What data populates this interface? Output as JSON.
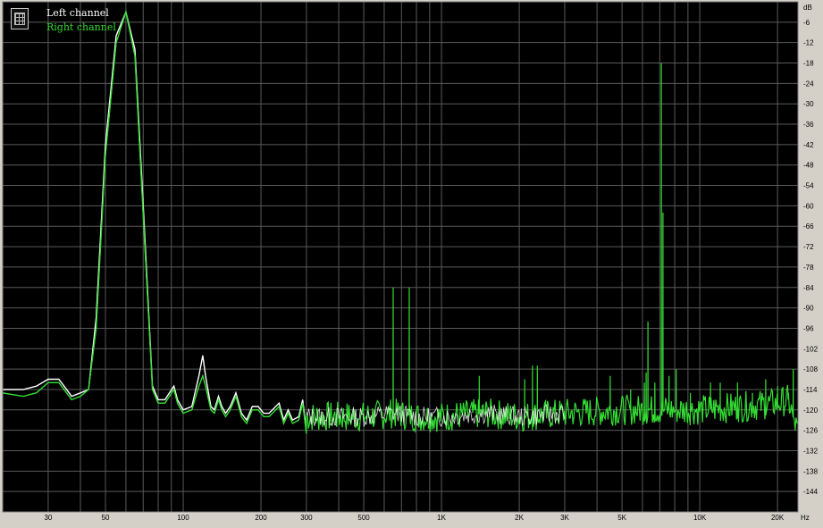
{
  "chart_data": {
    "type": "line",
    "x_scale": "log",
    "xlim": [
      20,
      24000
    ],
    "ylim": [
      -150,
      0
    ],
    "y_unit": "dB",
    "x_unit": "Hz",
    "grid": true,
    "legend_position": "top-left",
    "colors": {
      "background": "#000000",
      "grid": "#5a5a5a",
      "left": "#ffffff",
      "right": "#33dd33"
    },
    "x_ticks": [
      {
        "value": 30,
        "label": "30"
      },
      {
        "value": 50,
        "label": "50"
      },
      {
        "value": 100,
        "label": "100"
      },
      {
        "value": 200,
        "label": "200"
      },
      {
        "value": 300,
        "label": "300"
      },
      {
        "value": 500,
        "label": "500"
      },
      {
        "value": 1000,
        "label": "1K"
      },
      {
        "value": 2000,
        "label": "2K"
      },
      {
        "value": 3000,
        "label": "3K"
      },
      {
        "value": 5000,
        "label": "5K"
      },
      {
        "value": 10000,
        "label": "10K"
      },
      {
        "value": 20000,
        "label": "20K"
      }
    ],
    "y_ticks": [
      -6,
      -12,
      -18,
      -24,
      -30,
      -36,
      -42,
      -48,
      -54,
      -60,
      -66,
      -72,
      -78,
      -84,
      -90,
      -96,
      -102,
      -108,
      -114,
      -120,
      -126,
      -132,
      -138,
      -144
    ],
    "series": [
      {
        "name": "Left channel",
        "color": "#ffffff",
        "points": [
          [
            20,
            -114
          ],
          [
            24,
            -114
          ],
          [
            27,
            -113
          ],
          [
            30,
            -111
          ],
          [
            33,
            -111
          ],
          [
            37,
            -116
          ],
          [
            40,
            -115
          ],
          [
            43,
            -114
          ],
          [
            46,
            -93
          ],
          [
            50,
            -42
          ],
          [
            55,
            -10
          ],
          [
            60,
            -3
          ],
          [
            65,
            -14
          ],
          [
            70,
            -60
          ],
          [
            76,
            -113
          ],
          [
            80,
            -117
          ],
          [
            85,
            -117
          ],
          [
            92,
            -113
          ],
          [
            95,
            -117
          ],
          [
            100,
            -120
          ],
          [
            108,
            -119
          ],
          [
            115,
            -110
          ],
          [
            119,
            -104
          ],
          [
            122,
            -110
          ],
          [
            128,
            -119
          ],
          [
            132,
            -120
          ],
          [
            137,
            -116
          ],
          [
            141,
            -119
          ],
          [
            146,
            -121
          ],
          [
            152,
            -119
          ],
          [
            160,
            -115
          ],
          [
            168,
            -121
          ],
          [
            176,
            -123
          ],
          [
            185,
            -119
          ],
          [
            195,
            -119
          ],
          [
            205,
            -121
          ],
          [
            215,
            -121
          ],
          [
            235,
            -118
          ],
          [
            245,
            -123
          ],
          [
            255,
            -120
          ],
          [
            265,
            -123
          ],
          [
            280,
            -122
          ],
          [
            290,
            -117
          ],
          [
            300,
            -126
          ]
        ]
      },
      {
        "name": "Right channel",
        "color": "#33dd33",
        "points": [
          [
            20,
            -115
          ],
          [
            24,
            -116
          ],
          [
            27,
            -115
          ],
          [
            30,
            -112
          ],
          [
            33,
            -112
          ],
          [
            37,
            -117
          ],
          [
            40,
            -116
          ],
          [
            43,
            -114
          ],
          [
            46,
            -96
          ],
          [
            50,
            -45
          ],
          [
            55,
            -12
          ],
          [
            60,
            -3
          ],
          [
            65,
            -16
          ],
          [
            70,
            -63
          ],
          [
            76,
            -114
          ],
          [
            80,
            -118
          ],
          [
            85,
            -118
          ],
          [
            92,
            -114
          ],
          [
            95,
            -118
          ],
          [
            100,
            -121
          ],
          [
            108,
            -120
          ],
          [
            115,
            -113
          ],
          [
            119,
            -110
          ],
          [
            122,
            -113
          ],
          [
            128,
            -120
          ],
          [
            132,
            -121
          ],
          [
            137,
            -117
          ],
          [
            141,
            -120
          ],
          [
            146,
            -122
          ],
          [
            152,
            -120
          ],
          [
            160,
            -116
          ],
          [
            168,
            -122
          ],
          [
            176,
            -124
          ],
          [
            185,
            -120
          ],
          [
            195,
            -120
          ],
          [
            205,
            -122
          ],
          [
            215,
            -122
          ],
          [
            235,
            -119
          ],
          [
            245,
            -124
          ],
          [
            255,
            -121
          ],
          [
            265,
            -124
          ],
          [
            280,
            -123
          ],
          [
            290,
            -118
          ],
          [
            300,
            -127
          ]
        ],
        "noise_floor": [
          [
            300,
            -122
          ],
          [
            500,
            -122
          ],
          [
            650,
            -121
          ],
          [
            800,
            -122
          ],
          [
            1000,
            -122
          ],
          [
            1500,
            -121
          ],
          [
            2000,
            -122
          ],
          [
            3000,
            -121
          ],
          [
            5000,
            -120
          ],
          [
            7000,
            -120
          ],
          [
            10000,
            -120
          ],
          [
            15000,
            -119
          ],
          [
            20000,
            -118
          ],
          [
            22000,
            -117
          ],
          [
            24000,
            -127
          ]
        ],
        "peaks": [
          [
            650,
            -84
          ],
          [
            750,
            -84
          ],
          [
            1400,
            -110
          ],
          [
            2100,
            -111
          ],
          [
            2250,
            -107
          ],
          [
            2350,
            -107
          ],
          [
            4500,
            -110
          ],
          [
            5400,
            -114
          ],
          [
            6100,
            -112
          ],
          [
            6200,
            -109
          ],
          [
            6300,
            -94
          ],
          [
            6700,
            -112
          ],
          [
            7100,
            -18
          ],
          [
            7200,
            -62
          ],
          [
            7600,
            -110
          ],
          [
            8100,
            -108
          ],
          [
            9200,
            -115
          ],
          [
            11000,
            -112
          ],
          [
            12000,
            -112
          ],
          [
            14000,
            -112
          ],
          [
            16000,
            -115
          ],
          [
            18000,
            -111
          ],
          [
            20000,
            -113
          ],
          [
            22000,
            -115
          ],
          [
            23000,
            -108
          ]
        ]
      }
    ]
  },
  "legend": {
    "left_label": "Left channel",
    "right_label": "Right channel"
  },
  "axis": {
    "y_unit_label": "dB",
    "x_unit_label": "Hz"
  }
}
